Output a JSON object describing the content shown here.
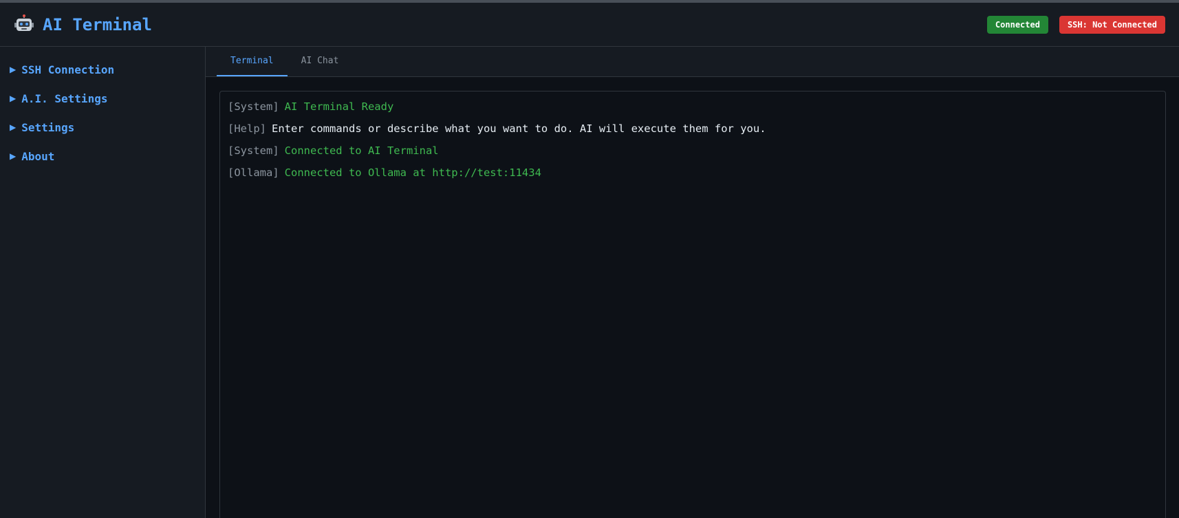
{
  "app": {
    "title": "AI Terminal",
    "icon": "robot-icon"
  },
  "status": {
    "connection": {
      "label": "Connected",
      "color": "#238636"
    },
    "ssh": {
      "label": "SSH: Not Connected",
      "color": "#da3633"
    }
  },
  "sidebar": {
    "items": [
      {
        "label": "SSH Connection",
        "icon": "triangle-right-icon"
      },
      {
        "label": "A.I. Settings",
        "icon": "triangle-right-icon"
      },
      {
        "label": "Settings",
        "icon": "triangle-right-icon"
      },
      {
        "label": "About",
        "icon": "triangle-right-icon"
      }
    ]
  },
  "tabs": [
    {
      "label": "Terminal",
      "active": true
    },
    {
      "label": "AI Chat",
      "active": false
    }
  ],
  "terminal": {
    "lines": [
      {
        "tag": "[System]",
        "text": "AI Terminal Ready",
        "style": "green"
      },
      {
        "tag": "[Help]",
        "text": "Enter commands or describe what you want to do. AI will execute them for you.",
        "style": "white"
      },
      {
        "tag": "[System]",
        "text": "Connected to AI Terminal",
        "style": "green"
      },
      {
        "tag": "[Ollama]",
        "text": "Connected to Ollama at http://test:11434",
        "style": "green"
      }
    ]
  },
  "colors": {
    "accent": "#58a6ff",
    "success_text": "#3fb950",
    "background": "#0d1117",
    "panel": "#161b22"
  }
}
